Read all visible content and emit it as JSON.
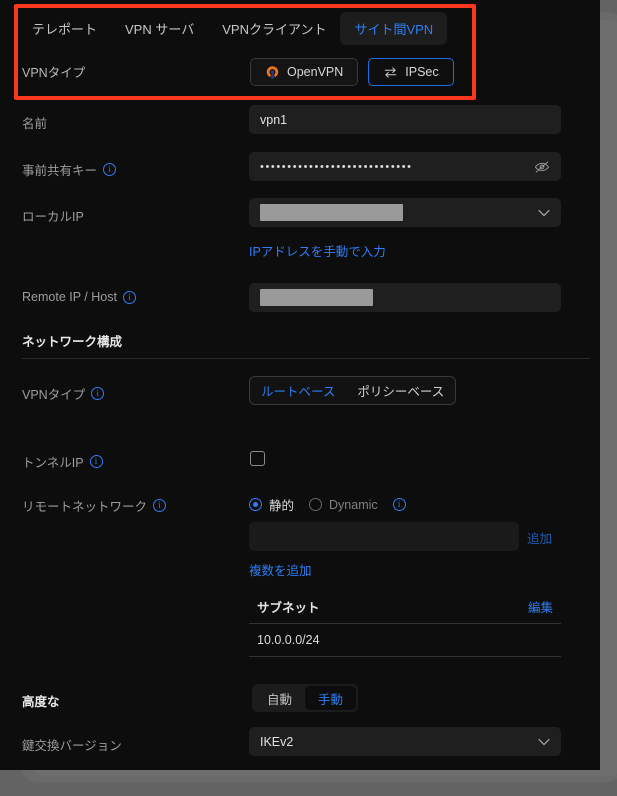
{
  "tabs": [
    {
      "label": "テレポート",
      "active": false
    },
    {
      "label": "VPN サーバ",
      "active": false
    },
    {
      "label": "VPNクライアント",
      "active": false
    },
    {
      "label": "サイト間VPN",
      "active": true
    }
  ],
  "vpn_type": {
    "label": "VPNタイプ",
    "options": [
      {
        "label": "OpenVPN",
        "icon": "openvpn-icon",
        "selected": false
      },
      {
        "label": "IPSec",
        "icon": "ipsec-arrows-icon",
        "selected": true
      }
    ]
  },
  "fields": {
    "name": {
      "label": "名前",
      "value": "vpn1"
    },
    "preshared_key": {
      "label": "事前共有キー",
      "value": "••••••••••••••••••••••••••••",
      "hidden": true,
      "toggle_icon": "eye-off-icon"
    },
    "local_ip": {
      "label": "ローカルIP",
      "value": "",
      "redacted": true,
      "manual_link": "IPアドレスを手動で入力"
    },
    "remote_ip_host": {
      "label": "Remote IP / Host",
      "value": "",
      "redacted": true
    }
  },
  "network_section": {
    "title": "ネットワーク構成",
    "vpn_type": {
      "label": "VPNタイプ",
      "options": [
        {
          "label": "ルートベース",
          "selected": true
        },
        {
          "label": "ポリシーベース",
          "selected": false
        }
      ]
    },
    "tunnel_ip": {
      "label": "トンネルIP",
      "checked": false
    },
    "remote_network": {
      "label": "リモートネットワーク",
      "modes": [
        {
          "label": "静的",
          "selected": true
        },
        {
          "label": "Dynamic",
          "selected": false
        }
      ],
      "input_value": "",
      "add_button": "追加",
      "add_multiple_link": "複数を追加",
      "table": {
        "column": "サブネット",
        "edit_label": "編集",
        "rows": [
          "10.0.0.0/24"
        ]
      }
    }
  },
  "advanced_section": {
    "title": "高度な",
    "mode": [
      {
        "label": "自動",
        "selected": false
      },
      {
        "label": "手動",
        "selected": true
      }
    ],
    "key_exchange": {
      "label": "鍵交換バージョン",
      "value": "IKEv2"
    }
  },
  "colors": {
    "accent_blue": "#2f7ef6",
    "highlight_red": "#f9381e",
    "openvpn_orange": "#e8741c",
    "panel_bg": "#0d0d0d"
  }
}
